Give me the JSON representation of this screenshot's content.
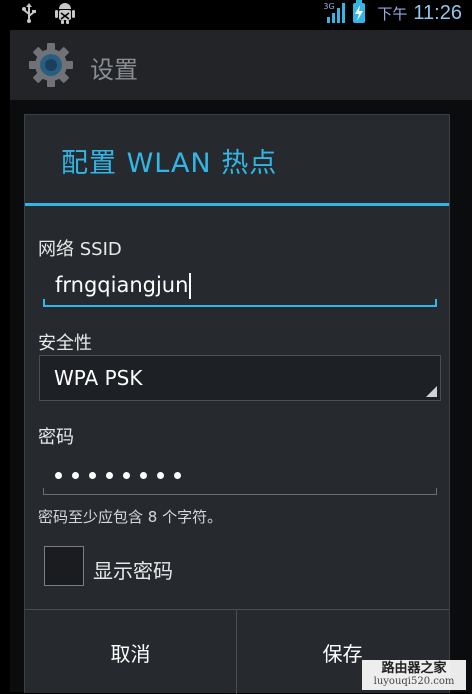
{
  "status_bar": {
    "left_icons": [
      "usb-icon",
      "android-debug-icon"
    ],
    "network": "3G",
    "ampm": "下午",
    "time": "11:26"
  },
  "app_bar": {
    "icon": "gear-icon",
    "title": "设置"
  },
  "dialog": {
    "title": "配置 WLAN 热点",
    "ssid_label": "网络 SSID",
    "ssid_value": "frngqiangjun",
    "security_label": "安全性",
    "security_value": "WPA PSK",
    "password_label": "密码",
    "password_mask": "••••••••",
    "password_hint": "密码至少应包含 8 个字符。",
    "show_password_label": "显示密码",
    "show_password_checked": false,
    "cancel_label": "取消",
    "save_label": "保存"
  },
  "watermark": {
    "line1": "路由器之家",
    "line2": "luyouqi520.com"
  },
  "colors": {
    "accent": "#33b5e5",
    "dialog_bg": "#262a2f"
  }
}
